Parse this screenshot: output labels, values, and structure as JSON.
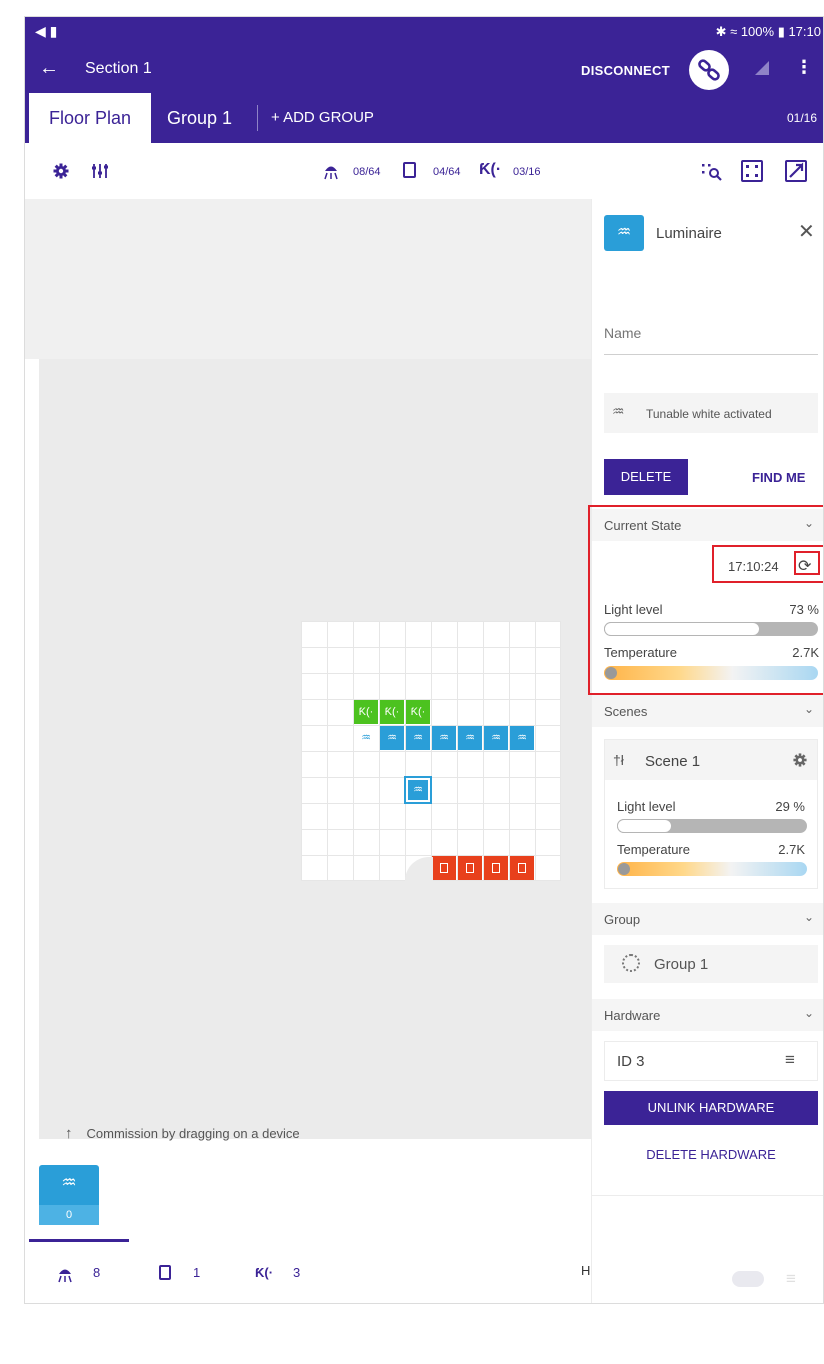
{
  "status_bar": {
    "left_icons": "◀ ▮",
    "right": "✱ ≈ 100% ▮ 17:10"
  },
  "app_bar": {
    "title": "Section 1",
    "disconnect_label": "DISCONNECT",
    "back_icon": "←",
    "more_icon": "⋮"
  },
  "tabs": {
    "floor_plan": "Floor Plan",
    "group": "Group 1",
    "add_group": "+ ADD GROUP",
    "counter": "01/16"
  },
  "toolbar": {
    "luminaire_count": "08/64",
    "switch_count": "04/64",
    "sensor_count": "03/16"
  },
  "canvas": {
    "commission_hint": "Commission by dragging on a device",
    "node_count": "0"
  },
  "bottom_bar": {
    "luminaires": "8",
    "switches": "1",
    "sensors": "3",
    "hidden_label": "H"
  },
  "panel": {
    "title": "Luminaire",
    "name_placeholder": "Name",
    "tunable_white": "Tunable white activated",
    "delete_label": "DELETE",
    "find_me_label": "FIND ME",
    "current_state": {
      "header": "Current State",
      "time": "17:10:24",
      "light_level_label": "Light level",
      "light_level_value": "73 %",
      "light_level_fraction": 0.73,
      "temperature_label": "Temperature",
      "temperature_value": "2.7K"
    },
    "scenes": {
      "header": "Scenes",
      "scene_name": "Scene 1",
      "light_level_label": "Light level",
      "light_level_value": "29 %",
      "light_level_fraction": 0.29,
      "temperature_label": "Temperature",
      "temperature_value": "2.7K"
    },
    "group": {
      "header": "Group",
      "name": "Group 1"
    },
    "hardware": {
      "header": "Hardware",
      "id": "ID 3",
      "unlink_label": "UNLINK HARDWARE",
      "delete_label": "DELETE HARDWARE"
    }
  },
  "colors": {
    "primary": "#3b2396",
    "highlight": "#e0202a",
    "sensor_green": "#4cc21f",
    "luminaire_blue": "#2a9ed8",
    "switch_red": "#e8401c"
  }
}
